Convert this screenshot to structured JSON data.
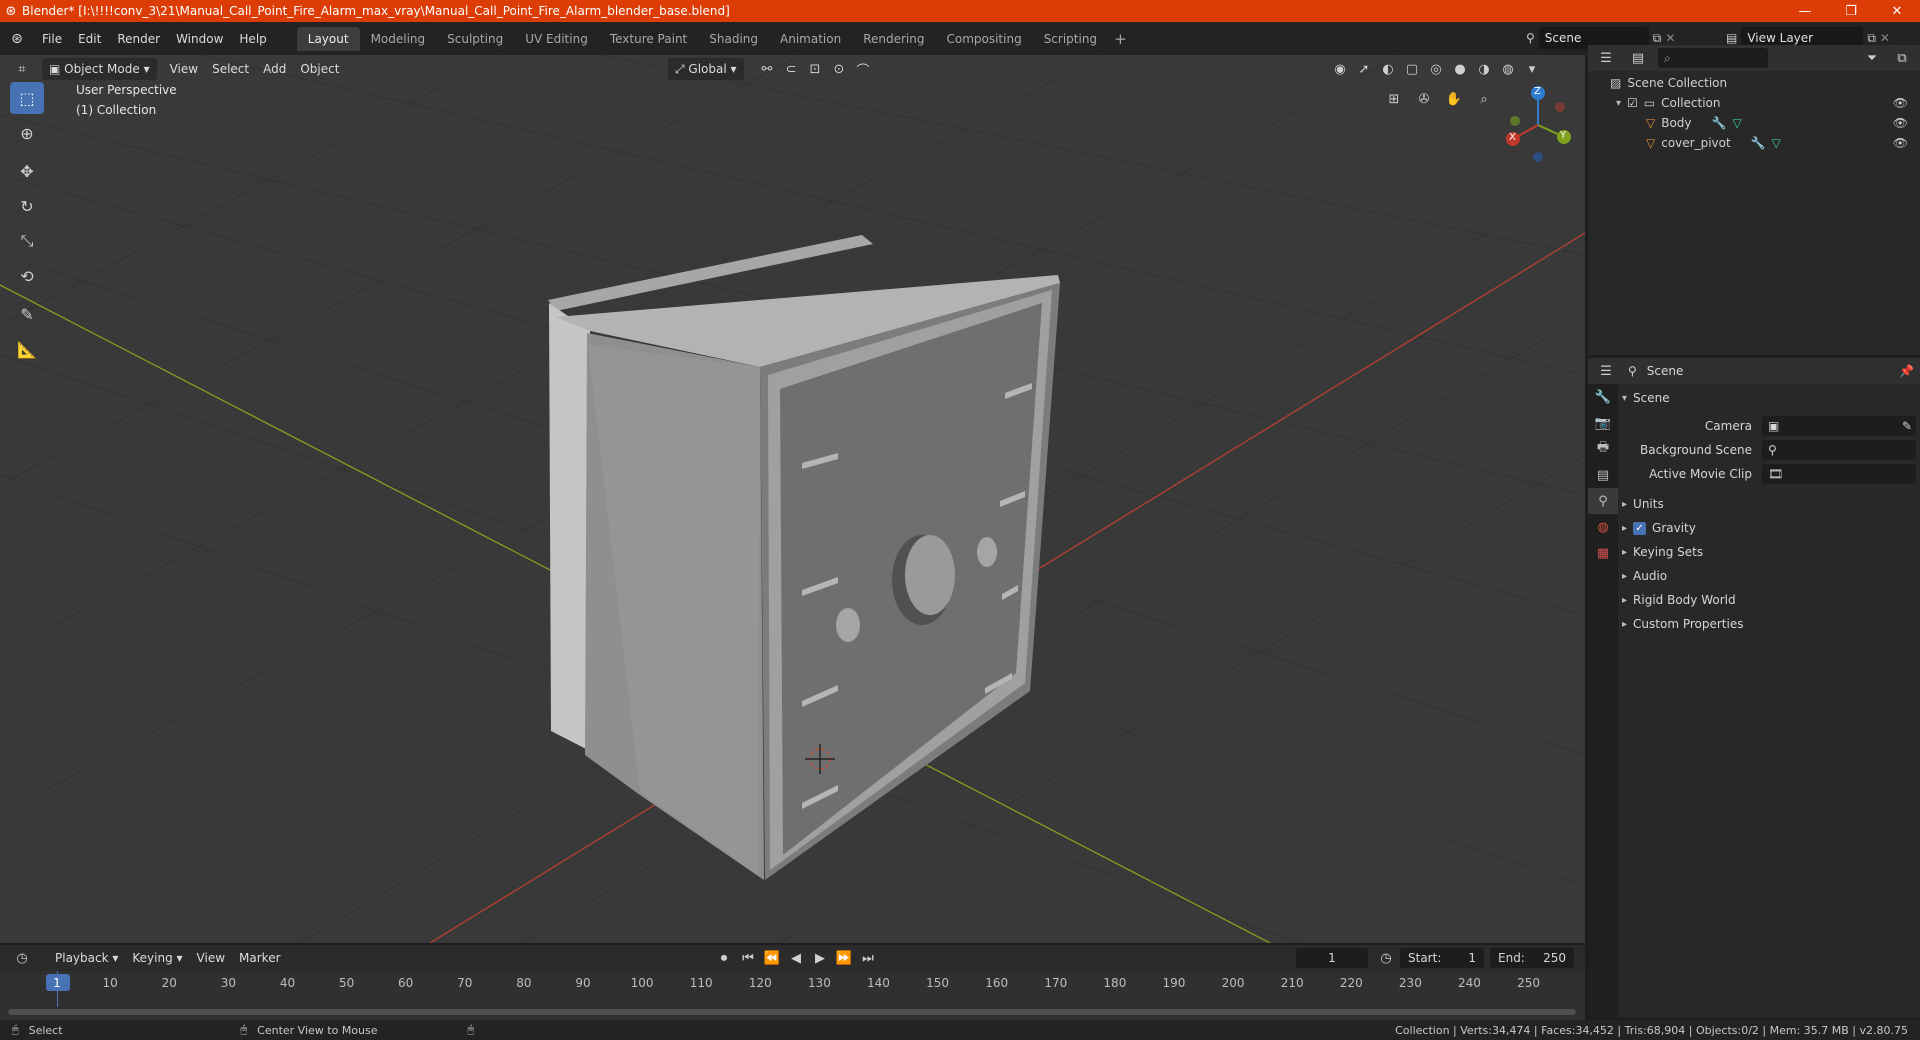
{
  "window": {
    "title": "Blender* [I:\\!!!!conv_3\\21\\Manual_Call_Point_Fire_Alarm_max_vray\\Manual_Call_Point_Fire_Alarm_blender_base.blend]",
    "minimize": "—",
    "restore": "❐",
    "close": "✕"
  },
  "menu": [
    "File",
    "Edit",
    "Render",
    "Window",
    "Help"
  ],
  "workspaces": [
    "Layout",
    "Modeling",
    "Sculpting",
    "UV Editing",
    "Texture Paint",
    "Shading",
    "Animation",
    "Rendering",
    "Compositing",
    "Scripting"
  ],
  "active_workspace": "Layout",
  "scene_field": "Scene",
  "view_layer_field": "View Layer",
  "viewport_header": {
    "mode": "Object Mode",
    "view": "View",
    "select": "Select",
    "add": "Add",
    "object": "Object",
    "orientation": "Global"
  },
  "viewport": {
    "perspective_label": "User Perspective",
    "collection_label": "(1) Collection",
    "gizmo": {
      "x": "X",
      "y": "Y",
      "z": "Z"
    }
  },
  "outliner": {
    "root": "Scene Collection",
    "collection": "Collection",
    "objects": [
      "Body",
      "cover_pivot"
    ]
  },
  "properties": {
    "header": "Scene",
    "section": "Scene",
    "fields": [
      {
        "label": "Camera",
        "value": ""
      },
      {
        "label": "Background Scene",
        "value": ""
      },
      {
        "label": "Active Movie Clip",
        "value": ""
      }
    ],
    "subsections": [
      "Units",
      "Gravity",
      "Keying Sets",
      "Audio",
      "Rigid Body World",
      "Custom Properties"
    ],
    "gravity_checked": true
  },
  "timeline": {
    "playback": "Playback",
    "keying": "Keying",
    "view": "View",
    "marker": "Marker",
    "current_frame": "1",
    "start_label": "Start:",
    "start": "1",
    "end_label": "End:",
    "end": "250",
    "ticks": [
      "1",
      "10",
      "20",
      "30",
      "40",
      "50",
      "60",
      "70",
      "80",
      "90",
      "100",
      "110",
      "120",
      "130",
      "140",
      "150",
      "160",
      "170",
      "180",
      "190",
      "200",
      "210",
      "220",
      "230",
      "240",
      "250"
    ]
  },
  "statusbar": {
    "select": "Select",
    "center_view": "Center View to Mouse",
    "stats": "Collection | Verts:34,474 | Faces:34,452 | Tris:68,904 | Objects:0/2 | Mem: 35.7 MB | v2.80.75"
  },
  "colors": {
    "title_bar": "#dc3d06",
    "accent_blue": "#4772b3",
    "viewport_bg": "#393939",
    "axis_x": "#c0392b",
    "axis_y": "#7fa11c"
  }
}
